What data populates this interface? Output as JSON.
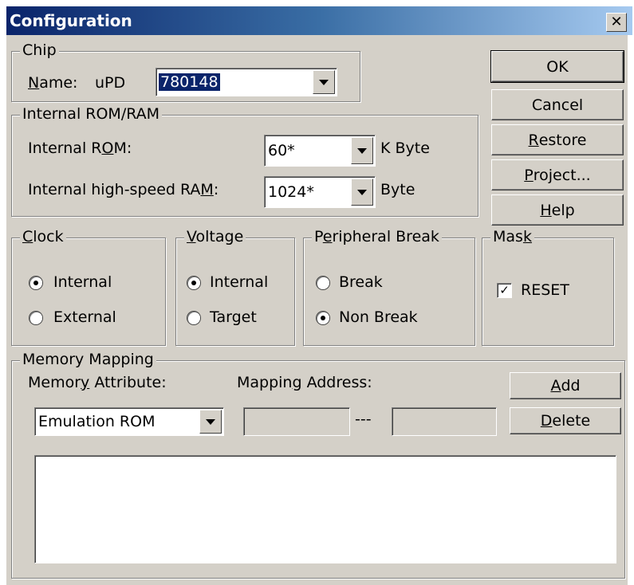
{
  "window": {
    "title": "Configuration",
    "close_icon": "close-icon"
  },
  "chip": {
    "legend": "Chip",
    "name_label_key": "N",
    "name_label_rest": "ame:",
    "prefix": "uPD",
    "value": "780148"
  },
  "memory": {
    "legend": "Internal ROM/RAM",
    "rom_label_a": "Internal R",
    "rom_label_key": "O",
    "rom_label_b": "M:",
    "rom_value": "60*",
    "rom_unit": "K Byte",
    "ram_label_a": "Internal high-speed RA",
    "ram_label_key": "M",
    "ram_label_b": ":",
    "ram_value": "1024*",
    "ram_unit": "Byte"
  },
  "buttons": {
    "ok": "OK",
    "cancel": "Cancel",
    "restore_key": "R",
    "restore_rest": "estore",
    "project_key": "P",
    "project_rest": "roject...",
    "help_key": "H",
    "help_rest": "elp"
  },
  "clock": {
    "legend_key": "C",
    "legend_rest": "lock",
    "opt1": "Internal",
    "opt2": "External",
    "selected": "Internal"
  },
  "voltage": {
    "legend_key": "V",
    "legend_rest": "oltage",
    "opt1": "Internal",
    "opt2": "Target",
    "selected": "Internal"
  },
  "peripheral": {
    "legend_a": "P",
    "legend_key": "e",
    "legend_b": "ripheral Break",
    "opt1": "Break",
    "opt2": "Non Break",
    "selected": "Non Break"
  },
  "mask": {
    "legend_a": "Mas",
    "legend_key": "k",
    "reset_label": "RESET",
    "reset_checked": true
  },
  "mapping": {
    "legend": "Memory Mapping",
    "attr_label_a": "Memor",
    "attr_label_key": "y",
    "attr_label_b": " Attribute:",
    "addr_label_a": "Mappin",
    "addr_label_key": "g",
    "addr_label_b": " Address:",
    "attr_value": "Emulation ROM",
    "separator": "---",
    "add_key": "A",
    "add_rest": "dd",
    "delete_key": "D",
    "delete_rest": "elete"
  }
}
